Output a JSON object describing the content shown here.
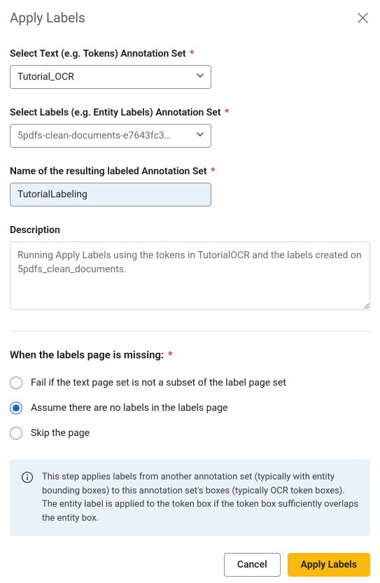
{
  "header": {
    "title": "Apply Labels"
  },
  "fields": {
    "text_set": {
      "label": "Select Text (e.g. Tokens) Annotation Set",
      "value": "Tutorial_OCR"
    },
    "labels_set": {
      "label": "Select Labels (e.g. Entity Labels) Annotation Set",
      "value": "5pdfs-clean-documents-e7643fc3…"
    },
    "result_name": {
      "label": "Name of the resulting labeled Annotation Set",
      "value": "TutorialLabeling"
    },
    "description": {
      "label": "Description",
      "value": "Running Apply Labels using the tokens in TutorialOCR and the labels created on 5pdfs_clean_documents."
    }
  },
  "missing_section": {
    "label": "When the labels page is missing:",
    "options": [
      {
        "label": "Fail if the text page set is not a subset of the label page set",
        "checked": false
      },
      {
        "label": "Assume there are no labels in the labels page",
        "checked": true
      },
      {
        "label": "Skip the page",
        "checked": false
      }
    ]
  },
  "info": {
    "text": "This step applies labels from another annotation set (typically with entity bounding boxes) to this annotation set's boxes (typically OCR token boxes). The entity label is applied to the token box if the token box sufficiently overlaps the entity box."
  },
  "footer": {
    "cancel": "Cancel",
    "apply": "Apply Labels"
  },
  "required_marker": "*"
}
